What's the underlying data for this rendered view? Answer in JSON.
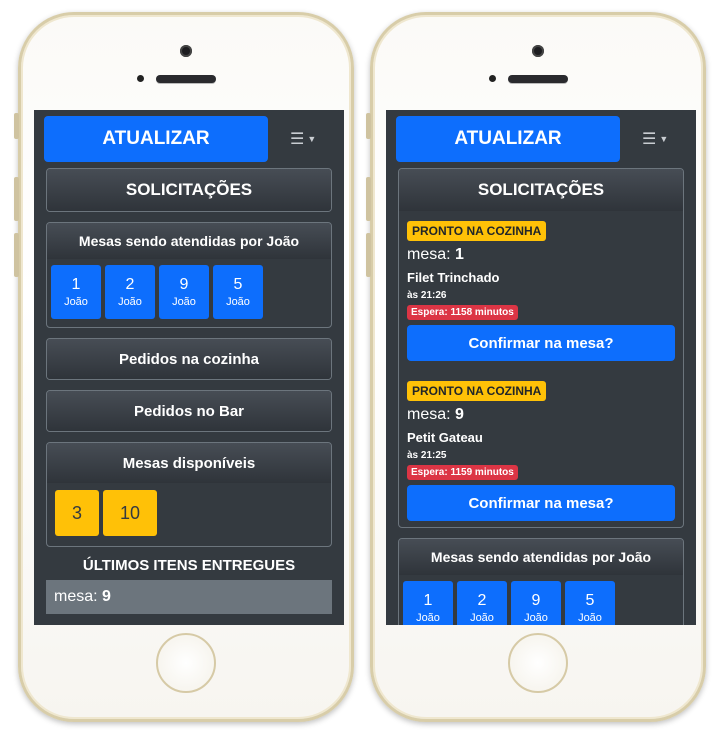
{
  "left": {
    "refresh_label": "ATUALIZAR",
    "menu_icon": "hamburger-icon",
    "solicitacoes_title": "SOLICITAÇÕES",
    "served_tables": {
      "title": "Mesas sendo atendidas por João",
      "tables": [
        {
          "number": "1",
          "waiter": "João"
        },
        {
          "number": "2",
          "waiter": "João"
        },
        {
          "number": "9",
          "waiter": "João"
        },
        {
          "number": "5",
          "waiter": "João"
        }
      ]
    },
    "kitchen_orders_title": "Pedidos na cozinha",
    "bar_orders_title": "Pedidos no Bar",
    "available_tables": {
      "title": "Mesas disponíveis",
      "tables": [
        "3",
        "10"
      ]
    },
    "last_delivered_title": "ÚLTIMOS ITENS ENTREGUES",
    "last_delivered": {
      "prefix": "mesa:",
      "number": "9"
    }
  },
  "right": {
    "refresh_label": "ATUALIZAR",
    "solicitacoes_title": "SOLICITAÇÕES",
    "orders": [
      {
        "status": "PRONTO NA COZINHA",
        "mesa_prefix": "mesa:",
        "mesa_number": "1",
        "item": "Filet Trinchado",
        "time": "às 21:26",
        "wait": "Espera: 1158 minutos",
        "confirm_label": "Confirmar na mesa?"
      },
      {
        "status": "PRONTO NA COZINHA",
        "mesa_prefix": "mesa:",
        "mesa_number": "9",
        "item": "Petit Gateau",
        "time": "às 21:25",
        "wait": "Espera: 1159 minutos",
        "confirm_label": "Confirmar na mesa?"
      }
    ],
    "served_tables": {
      "title": "Mesas sendo atendidas por João",
      "tables": [
        {
          "number": "1",
          "waiter": "João"
        },
        {
          "number": "2",
          "waiter": "João"
        },
        {
          "number": "9",
          "waiter": "João"
        },
        {
          "number": "5",
          "waiter": "João"
        }
      ]
    }
  },
  "colors": {
    "primary": "#0d6efd",
    "warning": "#ffc107",
    "danger": "#dc3545",
    "background": "#343a40"
  }
}
